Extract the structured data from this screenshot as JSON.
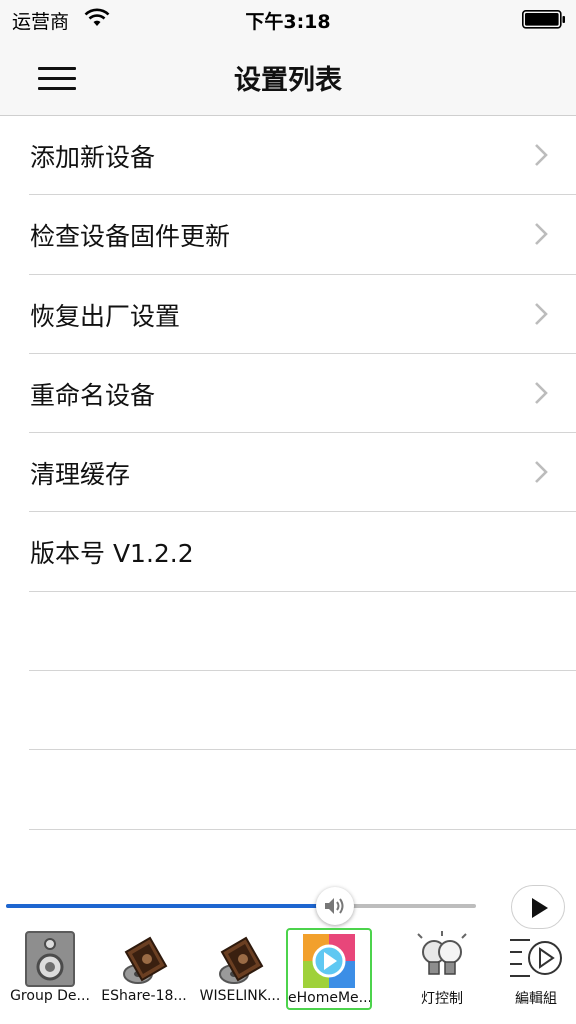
{
  "status_bar": {
    "carrier": "运营商",
    "time": "下午3:18"
  },
  "nav": {
    "title": "设置列表",
    "menu_icon": "hamburger-menu-icon"
  },
  "settings": {
    "items": [
      {
        "label": "添加新设备",
        "has_chevron": true
      },
      {
        "label": "检查设备固件更新",
        "has_chevron": true
      },
      {
        "label": "恢复出厂设置",
        "has_chevron": true
      },
      {
        "label": "重命名设备",
        "has_chevron": true
      },
      {
        "label": "清理缓存",
        "has_chevron": true
      },
      {
        "label": "版本号  V1.2.2",
        "has_chevron": false
      }
    ]
  },
  "player": {
    "volume_fraction": 0.7,
    "accent_color": "#1e66d0",
    "dock": [
      {
        "label": "Group De...",
        "icon": "speaker-icon"
      },
      {
        "label": "EShare-18...",
        "icon": "film-reel-icon"
      },
      {
        "label": "WISELINK...",
        "icon": "film-reel-icon"
      },
      {
        "label": "eHomeMe...",
        "icon": "ehome-media-icon",
        "selected": true
      },
      {
        "label": "灯控制",
        "icon": "light-bulbs-icon"
      },
      {
        "label": "編輯組",
        "icon": "edit-group-icon"
      }
    ]
  }
}
